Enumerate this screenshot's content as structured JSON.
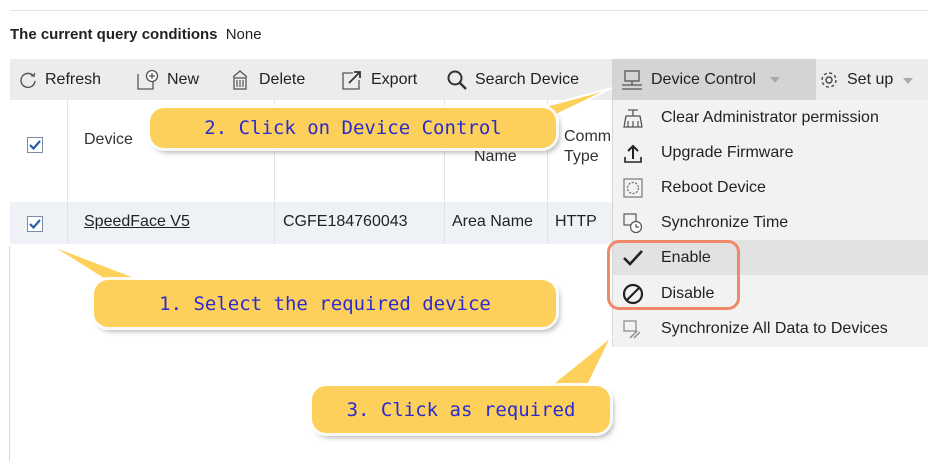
{
  "query": {
    "label": "The current query conditions",
    "value": "None"
  },
  "toolbar": {
    "refresh": "Refresh",
    "new": "New",
    "delete": "Delete",
    "export": "Export",
    "search_device": "Search Device",
    "device_control": "Device Control",
    "setup": "Set up"
  },
  "table": {
    "headers": {
      "device": "Device",
      "name": "Name",
      "comm": "Comm",
      "type": "Type"
    },
    "rows": [
      {
        "device_name": "SpeedFace V5",
        "serial": "CGFE184760043",
        "area": "Area Name",
        "comm_type": "HTTP"
      }
    ]
  },
  "menu": {
    "items": [
      {
        "label": "Clear Administrator permission",
        "icon": "admin-icon"
      },
      {
        "label": "Upgrade Firmware",
        "icon": "upload-icon"
      },
      {
        "label": "Reboot Device",
        "icon": "reboot-icon"
      },
      {
        "label": "Synchronize Time",
        "icon": "clock-icon"
      },
      {
        "label": "Enable",
        "icon": "check-icon"
      },
      {
        "label": "Disable",
        "icon": "disable-icon"
      },
      {
        "label": "Synchronize All Data to Devices",
        "icon": "sync-icon"
      }
    ]
  },
  "callouts": {
    "step1": "1. Select the required device",
    "step2": "2. Click on Device Control",
    "step3": "3. Click as required"
  },
  "colors": {
    "callout": "#fcd05a",
    "callout_text": "#2b2bd0",
    "highlight_ring": "#f0896a",
    "row_bg": "#eef1f6",
    "toolbar_bg": "#ececec"
  }
}
